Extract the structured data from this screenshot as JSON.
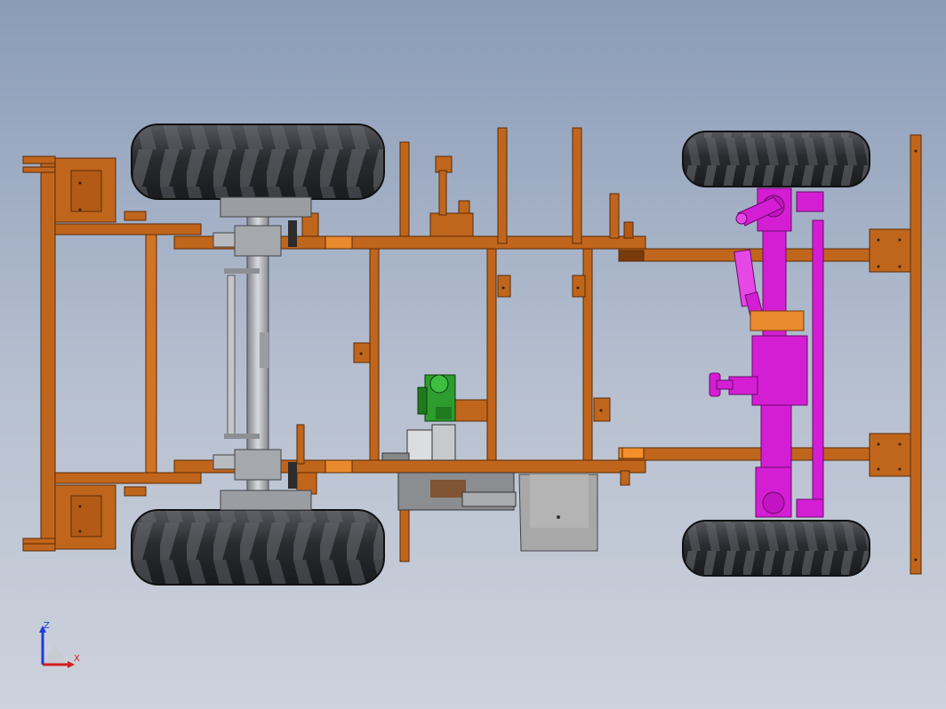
{
  "view": {
    "title": "",
    "background_top": "#8a9cb8",
    "background_bottom": "#cdd2dc"
  },
  "colors": {
    "frame": "#c0661c",
    "frame_dark": "#7a3a0c",
    "frame_light": "#e98a2e",
    "tire": "#2e2f33",
    "tire_tread": "#4a4c52",
    "axle": "#a9acb2",
    "steering": "#d41ed4",
    "pump": "#2e9c2e",
    "housing": "#a8a8a8"
  },
  "triad": {
    "z_label": "Z",
    "x_label": "X",
    "z_color": "#1e3cd6",
    "x_color": "#d21e1e"
  },
  "components": {
    "rear_wheels": [
      "rear-wheel-top",
      "rear-wheel-bottom"
    ],
    "front_wheels": [
      "front-wheel-top",
      "front-wheel-bottom"
    ],
    "icons": [
      "axis-triad-icon"
    ]
  }
}
